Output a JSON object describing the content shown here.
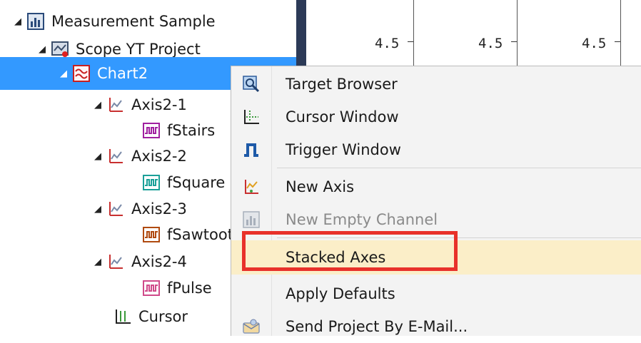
{
  "tree": {
    "items": [
      {
        "label": "Measurement Sample",
        "icon": "measurement-sample-icon",
        "expander": "◢"
      },
      {
        "label": "Scope YT Project",
        "icon": "scope-project-icon",
        "expander": "◢"
      },
      {
        "label": "Chart2",
        "icon": "chart-icon",
        "expander": "◢"
      },
      {
        "label": "Axis2-1",
        "icon": "axis-icon",
        "expander": "◢"
      },
      {
        "label": "fStairs",
        "icon": "channel-icon"
      },
      {
        "label": "Axis2-2",
        "icon": "axis-icon",
        "expander": "◢"
      },
      {
        "label": "fSquare",
        "icon": "channel-icon"
      },
      {
        "label": "Axis2-3",
        "icon": "axis-icon",
        "expander": "◢"
      },
      {
        "label": "fSawtooth",
        "icon": "channel-icon"
      },
      {
        "label": "Axis2-4",
        "icon": "axis-icon",
        "expander": "◢"
      },
      {
        "label": "fPulse",
        "icon": "channel-icon"
      },
      {
        "label": "Cursor",
        "icon": "cursor-icon"
      }
    ]
  },
  "chart": {
    "ticks": [
      "4.5",
      "4.5",
      "4.5"
    ]
  },
  "menu": {
    "items": [
      {
        "label": "Target Browser",
        "icon": "target-browser-icon"
      },
      {
        "label": "Cursor Window",
        "icon": "cursor-window-icon"
      },
      {
        "label": "Trigger Window",
        "icon": "trigger-window-icon"
      },
      {
        "label": "New Axis",
        "icon": "new-axis-icon"
      },
      {
        "label": "New Empty Channel",
        "icon": "new-channel-icon",
        "disabled": true
      },
      {
        "label": "Stacked Axes",
        "icon": "stacked-axes-icon",
        "highlighted": true
      },
      {
        "label": "Apply Defaults",
        "icon": "apply-defaults-icon"
      },
      {
        "label": "Send Project By E-Mail...",
        "icon": "email-icon"
      }
    ]
  },
  "colors": {
    "selection": "#3399ff",
    "hover": "#fbeec8",
    "highlight_border": "#e8312a",
    "scope_bar": "#2c3a57"
  }
}
